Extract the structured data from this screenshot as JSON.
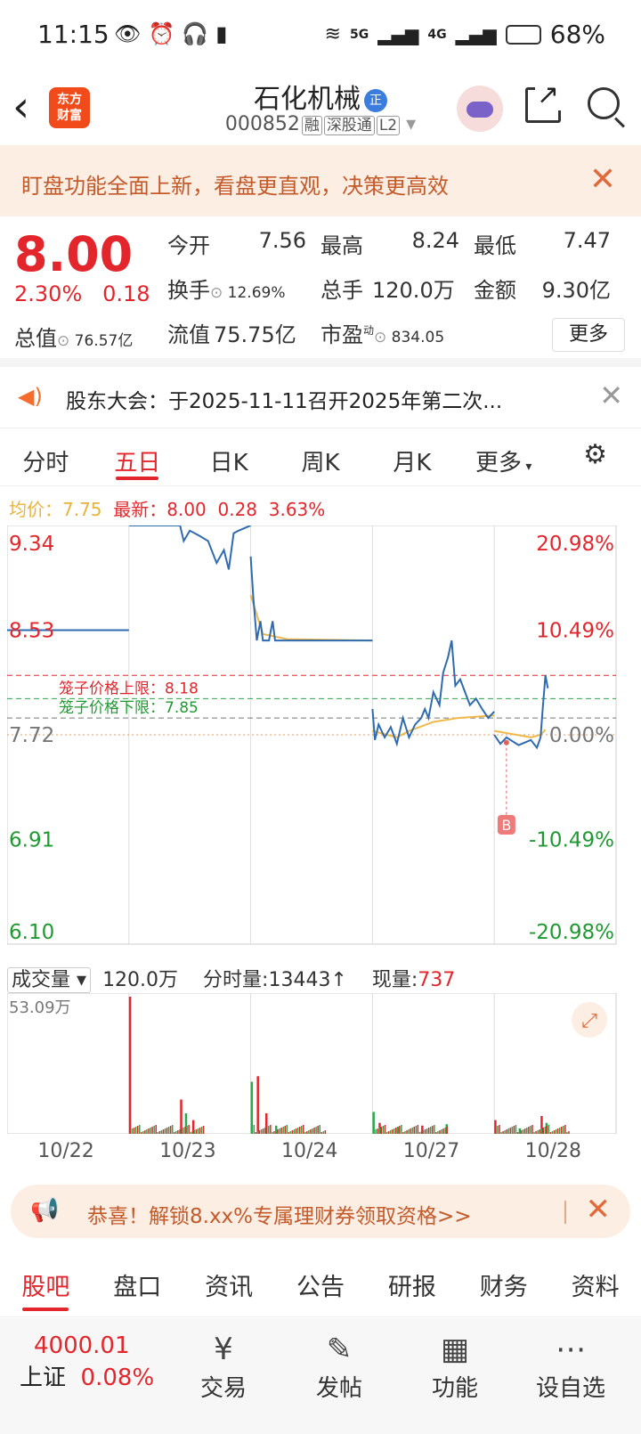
{
  "status": {
    "time": "11:15",
    "net1": "5G",
    "net2": "4G",
    "battery": "68%"
  },
  "header": {
    "name": "石化机械",
    "badge": "正",
    "code": "000852",
    "tags": [
      "融",
      "深股通",
      "L2"
    ],
    "logo": "东方\n财富"
  },
  "banner": {
    "text": "盯盘功能全面上新，看盘更直观，决策更高效"
  },
  "quote": {
    "price": "8.00",
    "change_pct": "2.30%",
    "change_amt": "0.18",
    "open_label": "今开",
    "open": "7.56",
    "high_label": "最高",
    "high": "8.24",
    "low_label": "最低",
    "low": "7.47",
    "turnover_label": "换手",
    "turnover": "12.69%",
    "volume_label": "总手",
    "volume": "120.0万",
    "amount_label": "金额",
    "amount": "9.30亿",
    "mcap_label": "总值",
    "mcap": "76.57亿",
    "float_label": "流值",
    "float": "75.75亿",
    "pe_label": "市盈",
    "pe_sup": "动",
    "pe": "834.05",
    "more": "更多"
  },
  "notice": {
    "text": "股东大会：于2025-11-11召开2025年第二次..."
  },
  "tabs": [
    "分时",
    "五日",
    "日K",
    "周K",
    "月K",
    "更多",
    "settings-icon"
  ],
  "active_tab": "五日",
  "legend": {
    "avg_label": "均价：",
    "avg": "7.75",
    "latest_label": "最新：",
    "latest": "8.00",
    "latest_chg": "0.28",
    "latest_pct": "3.63%"
  },
  "chart_data": {
    "type": "line",
    "y_left": [
      "9.34",
      "8.53",
      "7.72",
      "6.91",
      "6.10"
    ],
    "y_right": [
      "20.98%",
      "10.49%",
      "0.00%",
      "-10.49%",
      "-20.98%"
    ],
    "upper_limit_label": "笼子价格上限：8.18",
    "lower_limit_label": "笼子价格下限：7.85",
    "buy_marker": "B",
    "ylim": [
      6.1,
      9.34
    ],
    "days": [
      "10/22",
      "10/23",
      "10/24",
      "10/27",
      "10/28"
    ],
    "price_series": [
      [
        [
          0,
          8.53
        ],
        [
          1,
          8.53
        ]
      ],
      [
        [
          1,
          9.34
        ],
        [
          1.42,
          9.34
        ],
        [
          1.45,
          9.22
        ],
        [
          1.5,
          9.3
        ],
        [
          1.58,
          9.26
        ],
        [
          1.65,
          9.22
        ],
        [
          1.72,
          9.05
        ],
        [
          1.78,
          9.15
        ],
        [
          1.82,
          9.0
        ],
        [
          1.86,
          9.28
        ],
        [
          1.9,
          9.3
        ],
        [
          2,
          9.34
        ]
      ],
      [
        [
          2,
          9.1
        ],
        [
          2.02,
          8.8
        ],
        [
          2.05,
          8.45
        ],
        [
          2.08,
          8.6
        ],
        [
          2.1,
          8.45
        ],
        [
          2.15,
          8.45
        ],
        [
          2.18,
          8.6
        ],
        [
          2.2,
          8.45
        ],
        [
          3,
          8.45
        ]
      ],
      [
        [
          3,
          7.92
        ],
        [
          3.02,
          7.68
        ],
        [
          3.05,
          7.8
        ],
        [
          3.1,
          7.7
        ],
        [
          3.15,
          7.78
        ],
        [
          3.2,
          7.65
        ],
        [
          3.25,
          7.85
        ],
        [
          3.3,
          7.7
        ],
        [
          3.35,
          7.8
        ],
        [
          3.4,
          7.85
        ],
        [
          3.43,
          7.92
        ],
        [
          3.46,
          7.85
        ],
        [
          3.5,
          8.05
        ],
        [
          3.55,
          7.95
        ],
        [
          3.58,
          8.2
        ],
        [
          3.62,
          8.32
        ],
        [
          3.65,
          8.45
        ],
        [
          3.68,
          8.1
        ],
        [
          3.72,
          8.15
        ],
        [
          3.76,
          8.05
        ],
        [
          3.8,
          7.95
        ],
        [
          3.85,
          8.0
        ],
        [
          3.9,
          7.92
        ],
        [
          3.95,
          7.85
        ],
        [
          4.0,
          7.9
        ]
      ],
      [
        [
          4,
          7.72
        ],
        [
          4.05,
          7.65
        ],
        [
          4.1,
          7.7
        ],
        [
          4.2,
          7.64
        ],
        [
          4.3,
          7.68
        ],
        [
          4.35,
          7.62
        ],
        [
          4.38,
          7.7
        ],
        [
          4.4,
          7.95
        ],
        [
          4.42,
          8.18
        ],
        [
          4.44,
          8.08
        ]
      ]
    ],
    "avg_series": [
      [
        [
          2,
          8.8
        ],
        [
          2.1,
          8.5
        ],
        [
          2.3,
          8.46
        ],
        [
          3,
          8.45
        ]
      ],
      [
        [
          3,
          7.75
        ],
        [
          3.2,
          7.7
        ],
        [
          3.3,
          7.75
        ],
        [
          3.5,
          7.82
        ],
        [
          3.7,
          7.85
        ],
        [
          4,
          7.87
        ]
      ],
      [
        [
          4,
          7.75
        ],
        [
          4.3,
          7.7
        ],
        [
          4.38,
          7.72
        ],
        [
          4.42,
          7.76
        ]
      ]
    ],
    "volume": {
      "label": "成交量",
      "total": "120.0万",
      "tick_label": "分时量:",
      "tick": "13443",
      "now_label": "现量:",
      "now": "737",
      "max": "53.09万"
    }
  },
  "promo": {
    "text": "恭喜！解锁8.xx%专属理财券领取资格>>"
  },
  "bottom_tabs": [
    "股吧",
    "盘口",
    "资讯",
    "公告",
    "研报",
    "财务",
    "资料"
  ],
  "footer": {
    "index_value": "4000.01",
    "index_name": "上证",
    "index_pct": "0.08%",
    "buttons": [
      {
        "label": "交易",
        "icon": "yen-icon"
      },
      {
        "label": "发帖",
        "icon": "edit-icon"
      },
      {
        "label": "功能",
        "icon": "grid-icon"
      },
      {
        "label": "设自选",
        "icon": "dots-icon"
      }
    ]
  }
}
